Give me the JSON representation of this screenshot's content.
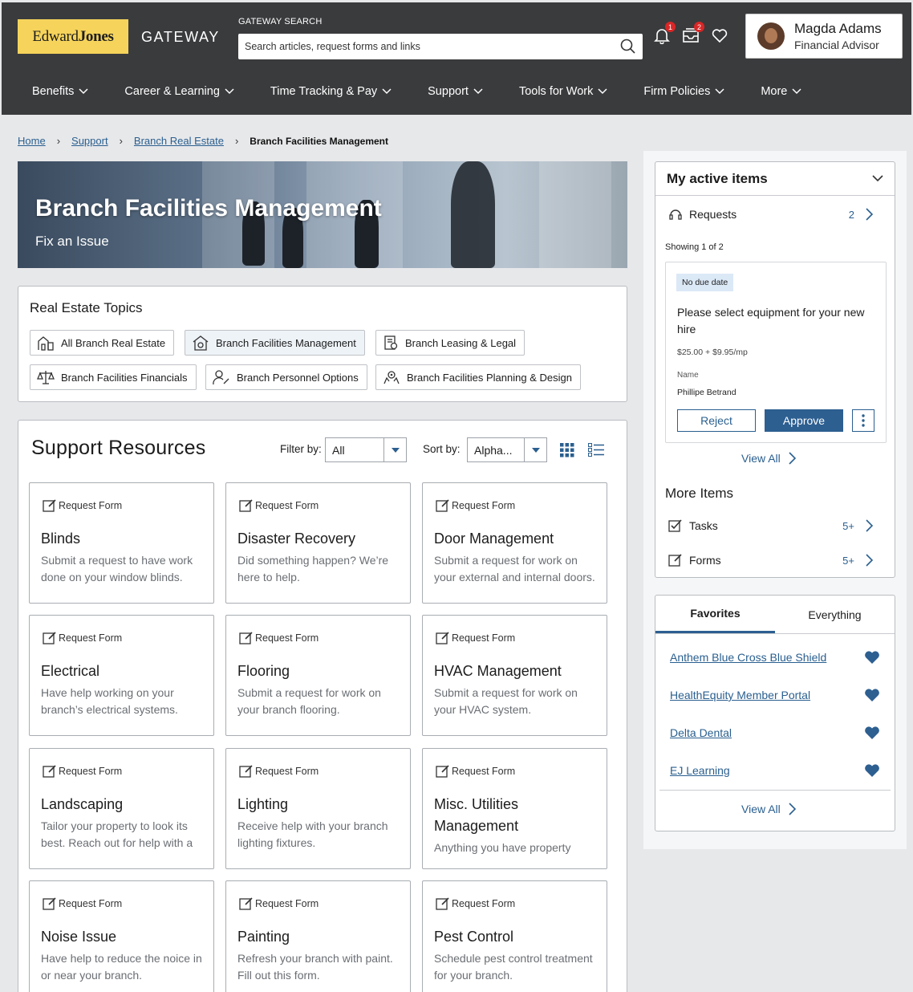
{
  "header": {
    "logo": {
      "part1": "Edward",
      "part2": "Jones"
    },
    "app_name": "GATEWAY",
    "search": {
      "label": "GATEWAY SEARCH",
      "placeholder": "Search articles, request forms and links"
    },
    "notifications_count": "1",
    "inbox_count": "2",
    "user": {
      "name": "Magda Adams",
      "role": "Financial Advisor"
    }
  },
  "nav": [
    "Benefits",
    "Career & Learning",
    "Time Tracking & Pay",
    "Support",
    "Tools for Work",
    "Firm Policies",
    "More"
  ],
  "breadcrumb": {
    "home": "Home",
    "support": "Support",
    "branch_real_estate": "Branch Real Estate",
    "current": "Branch Facilities Management"
  },
  "hero": {
    "title": "Branch Facilities Management",
    "subtitle": "Fix an Issue"
  },
  "topics": {
    "heading": "Real Estate Topics",
    "items": [
      "All Branch Real Estate",
      "Branch Facilities Management",
      "Branch Leasing & Legal",
      "Branch Facilities Financials",
      "Branch Personnel Options",
      "Branch Facilities Planning & Design"
    ]
  },
  "support": {
    "heading": "Support Resources",
    "filter_label": "Filter by:",
    "filter_value": "All",
    "sort_label": "Sort by:",
    "sort_value": "Alpha...",
    "card_type": "Request Form",
    "cards": [
      {
        "title": "Blinds",
        "desc": "Submit a request to have work done on your window blinds."
      },
      {
        "title": "Disaster Recovery",
        "desc": "Did something happen? We’re here to help."
      },
      {
        "title": "Door Management",
        "desc": "Submit a request for work on your external and internal doors."
      },
      {
        "title": "Electrical",
        "desc": "Have help working on your branch’s electrical systems."
      },
      {
        "title": "Flooring",
        "desc": "Submit a request for work on your branch flooring."
      },
      {
        "title": "HVAC Management",
        "desc": "Submit a request for work on your HVAC system."
      },
      {
        "title": "Landscaping",
        "desc": "Tailor your property to look its best. Reach out for help with a landscaper."
      },
      {
        "title": "Lighting",
        "desc": "Receive help with your branch lighting fixtures."
      },
      {
        "title": "Misc. Utilities Management",
        "desc": "Anything you have property"
      },
      {
        "title": "Noise Issue",
        "desc": "Have help to reduce the noice in or near your branch."
      },
      {
        "title": "Painting",
        "desc": "Refresh your branch with paint. Fill out this form."
      },
      {
        "title": "Pest Control",
        "desc": "Schedule pest control treatment for your branch."
      }
    ]
  },
  "active_items": {
    "heading": "My active items",
    "requests_label": "Requests",
    "requests_count": "2",
    "showing": "Showing 1 of 2",
    "item": {
      "tag": "No due date",
      "title": "Please select equipment for your new hire",
      "price": "$25.00 + $9.95/mp",
      "name_label": "Name",
      "name_value": "Phillipe Betrand",
      "reject": "Reject",
      "approve": "Approve"
    },
    "view_all": "View All",
    "more_heading": "More Items",
    "tasks_label": "Tasks",
    "tasks_count": "5+",
    "forms_label": "Forms",
    "forms_count": "5+"
  },
  "favorites": {
    "tab_favorites": "Favorites",
    "tab_everything": "Everything",
    "links": [
      "Anthem Blue Cross Blue Shield",
      "HealthEquity Member Portal",
      "Delta Dental",
      "EJ Learning"
    ],
    "view_all": "View All"
  },
  "colors": {
    "brand_yellow": "#f6d45b",
    "header_bg": "#3a3b3d",
    "link_blue": "#2a5f8f",
    "primary_button": "#2d5f91",
    "badge_red": "#d92626"
  }
}
